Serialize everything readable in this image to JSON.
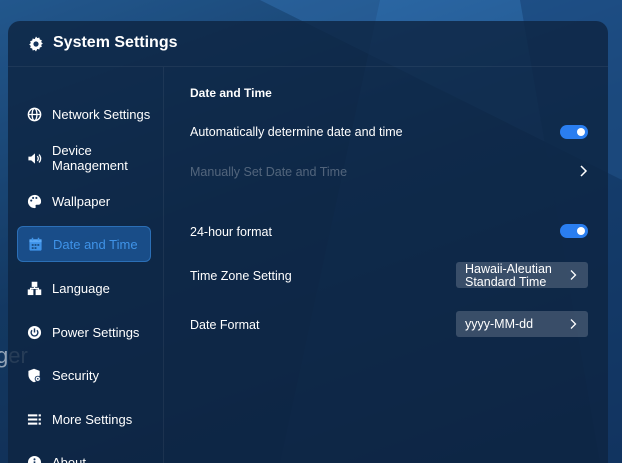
{
  "window": {
    "title": "System Settings"
  },
  "background": {
    "ghost_text": "ger"
  },
  "sidebar": {
    "items": [
      {
        "label": "Network Settings",
        "icon": "globe-icon"
      },
      {
        "label": "Device\nManagement",
        "icon": "speaker-icon"
      },
      {
        "label": "Wallpaper",
        "icon": "palette-icon"
      },
      {
        "label": "Date and Time",
        "icon": "calendar-icon",
        "active": true
      },
      {
        "label": "Language",
        "icon": "language-icon"
      },
      {
        "label": "Power Settings",
        "icon": "power-icon"
      },
      {
        "label": "Security",
        "icon": "shield-icon"
      },
      {
        "label": "More Settings",
        "icon": "list-icon"
      },
      {
        "label": "About",
        "icon": "info-icon"
      }
    ]
  },
  "content": {
    "title": "Date and Time",
    "rows": [
      {
        "label": "Automatically determine date and time",
        "control": "toggle",
        "value": true
      },
      {
        "label": "Manually Set Date and Time",
        "control": "chevron",
        "disabled": true
      },
      {
        "label": "24-hour format",
        "control": "toggle",
        "value": true
      },
      {
        "label": "Time Zone Setting",
        "control": "select",
        "value": "Hawaii-Aleutian Standard Time"
      },
      {
        "label": "Date Format",
        "control": "select",
        "value": "yyyy-MM-dd"
      }
    ]
  },
  "colors": {
    "accent": "#2a7ef0",
    "active_label": "#3f93e8",
    "panel": "#0e2442"
  }
}
